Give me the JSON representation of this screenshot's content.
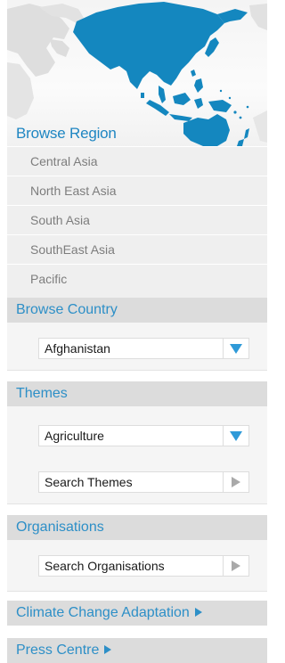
{
  "browse_region": {
    "title": "Browse Region",
    "regions": [
      "Central Asia",
      "North East Asia",
      "South Asia",
      "SouthEast Asia",
      "Pacific"
    ]
  },
  "browse_country": {
    "title": "Browse Country",
    "selected": "Afghanistan"
  },
  "themes": {
    "title": "Themes",
    "selected": "Agriculture",
    "search_label": "Search Themes"
  },
  "organisations": {
    "title": "Organisations",
    "search_label": "Search Organisations"
  },
  "links": {
    "climate_change": "Climate Change Adaptation",
    "press_centre": "Press Centre"
  },
  "colors": {
    "accent": "#2d8fc7",
    "map_land": "#1487bf",
    "header_bg": "#dcdcdc",
    "list_bg": "#efefef",
    "list_text": "#7d7d7d"
  },
  "icons": {
    "dropdown": "triangle-down-icon",
    "go": "triangle-right-icon",
    "link": "small-triangle-right-icon"
  }
}
